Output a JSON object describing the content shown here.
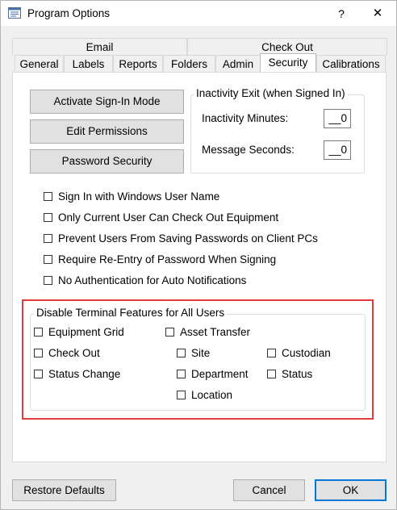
{
  "window": {
    "title": "Program Options",
    "help_glyph": "?",
    "close_glyph": "✕"
  },
  "tabs": {
    "row1": [
      "Email",
      "Check Out"
    ],
    "row2": [
      "General",
      "Labels",
      "Reports",
      "Folders",
      "Admin",
      "Security",
      "Calibrations"
    ],
    "selected": "Security"
  },
  "security": {
    "buttons": {
      "activate_sign_in": "Activate Sign-In Mode",
      "edit_permissions": "Edit Permissions",
      "password_security": "Password Security"
    },
    "inactivity_group": {
      "title": "Inactivity Exit (when Signed In)",
      "minutes_label": "Inactivity Minutes:",
      "minutes_value": "__0",
      "seconds_label": "Message Seconds:",
      "seconds_value": "__0"
    },
    "options": [
      {
        "label": "Sign In with Windows User Name",
        "checked": false
      },
      {
        "label": "Only Current User Can Check Out Equipment",
        "checked": false
      },
      {
        "label": "Prevent Users From Saving Passwords on Client PCs",
        "checked": false
      },
      {
        "label": "Require Re-Entry of Password When Signing",
        "checked": false
      },
      {
        "label": "No Authentication for Auto Notifications",
        "checked": false
      }
    ],
    "terminal_group": {
      "title": "Disable Terminal Features for All Users",
      "equipment_grid": "Equipment Grid",
      "check_out": "Check Out",
      "status_change": "Status Change",
      "asset_transfer": "Asset Transfer",
      "site": "Site",
      "department": "Department",
      "location": "Location",
      "custodian": "Custodian",
      "status": "Status"
    }
  },
  "footer": {
    "restore_defaults": "Restore Defaults",
    "cancel": "Cancel",
    "ok": "OK"
  },
  "colors": {
    "highlight": "#e03c3c",
    "default_button_border": "#0078d7"
  }
}
